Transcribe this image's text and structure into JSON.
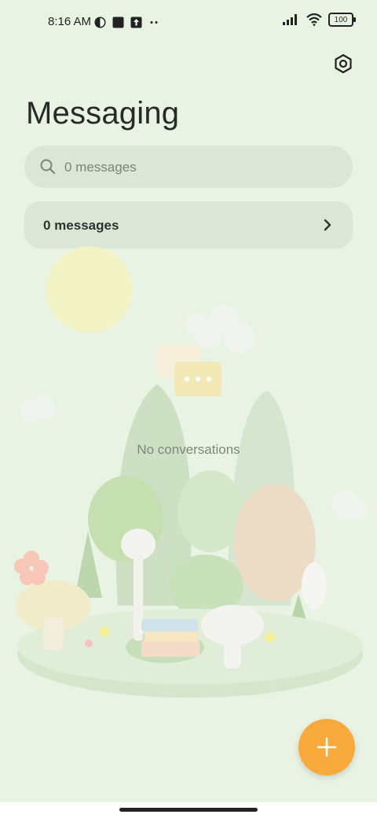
{
  "status_bar": {
    "time": "8:16 AM",
    "battery": "100"
  },
  "header": {
    "title": "Messaging"
  },
  "search": {
    "placeholder": "0 messages"
  },
  "summary": {
    "label": "0 messages"
  },
  "empty_state": {
    "text": "No conversations"
  },
  "icons": {
    "settings": "gear-icon",
    "search": "search-icon",
    "chevron": "chevron-right-icon",
    "compose": "plus-icon"
  },
  "colors": {
    "accent": "#f7a93b",
    "background": "#e9f3e3",
    "card": "#dbe6d6"
  }
}
